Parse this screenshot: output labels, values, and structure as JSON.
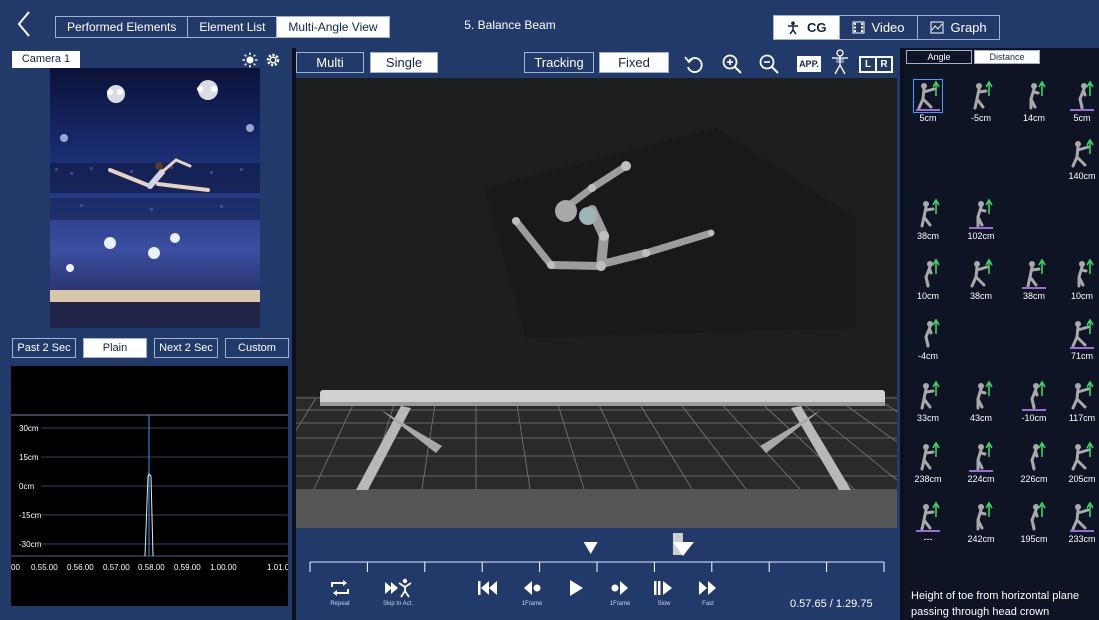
{
  "nav": {
    "back_icon": "back-chevron-icon",
    "tabs": [
      {
        "label": "Performed Elements",
        "active": false
      },
      {
        "label": "Element List",
        "active": false
      },
      {
        "label": "Multi-Angle View",
        "active": true
      }
    ],
    "title": "5. Balance Beam",
    "views": [
      {
        "label": "CG",
        "icon": "figure-icon",
        "active": true
      },
      {
        "label": "Video",
        "icon": "film-icon",
        "active": false
      },
      {
        "label": "Graph",
        "icon": "graph-icon",
        "active": false
      }
    ]
  },
  "camera": {
    "label": "Camera 1",
    "brightness_icon": "sun-icon",
    "settings_icon": "gear-icon"
  },
  "time_buttons": [
    {
      "label": "Past 2 Sec",
      "active": false
    },
    {
      "label": "Plain",
      "active": true
    },
    {
      "label": "Next 2 Sec",
      "active": false
    },
    {
      "label": "Custom",
      "active": false
    }
  ],
  "graph": {
    "y_ticks": [
      "30cm",
      "15cm",
      "0cm",
      "-15cm",
      "-30cm"
    ],
    "x_ticks": [
      "00",
      "0.55.00",
      "0.56.00",
      "0.57.00",
      "0.58.00",
      "0.59.00",
      "1.00.00",
      "1.01.0"
    ],
    "marker_position": 0.5765
  },
  "modes": {
    "view": [
      {
        "label": "Multi",
        "active": false
      },
      {
        "label": "Single",
        "active": true
      }
    ],
    "camera": [
      {
        "label": "Tracking",
        "active": false
      },
      {
        "label": "Fixed",
        "active": true
      }
    ],
    "app_label": "APP.",
    "left_label": "L",
    "right_label": "R",
    "tool_icons": [
      "rotate-reset-icon",
      "zoom-in-icon",
      "zoom-out-icon"
    ]
  },
  "timeline": {
    "progress": 0.6,
    "playhead": 0.648,
    "start_marker": 0.489
  },
  "controls": [
    {
      "caption": "Repeat",
      "icon": "repeat-icon"
    },
    {
      "caption": "Skip to Act.",
      "icon": "skip-to-action-icon"
    },
    {
      "caption": "",
      "icon": "skip-to-start-icon"
    },
    {
      "caption": "1Frame",
      "icon": "frame-back-icon"
    },
    {
      "caption": "",
      "icon": "play-icon"
    },
    {
      "caption": "1Frame",
      "icon": "frame-forward-icon"
    },
    {
      "caption": "Slow",
      "icon": "slow-icon"
    },
    {
      "caption": "Fast",
      "icon": "fast-icon"
    }
  ],
  "time_readout": "0.57.65 / 1.29.75",
  "measure": {
    "tabs": [
      {
        "label": "Angle",
        "active": false
      },
      {
        "label": "Distance",
        "active": true
      }
    ],
    "cells": [
      {
        "value": "5cm",
        "icon": "head-height-pose-icon",
        "selected": true
      },
      {
        "value": "-5cm",
        "icon": "crouch-pose-icon",
        "selected": false
      },
      {
        "value": "14cm",
        "icon": "arms-up-pose-icon",
        "selected": false
      },
      {
        "value": "5cm",
        "icon": "hip-height-pose-icon",
        "selected": false
      },
      {
        "value": "140cm",
        "icon": "foot-height-pose-icon",
        "selected": false
      },
      {
        "value": "38cm",
        "icon": "lean-pose-icon",
        "selected": false
      },
      {
        "value": "102cm",
        "icon": "split-pose-icon",
        "selected": false
      },
      {
        "value": "10cm",
        "icon": "knee-pose-icon",
        "selected": false
      },
      {
        "value": "38cm",
        "icon": "reach-pose-icon",
        "selected": false
      },
      {
        "value": "38cm",
        "icon": "leap-pose-icon",
        "selected": false
      },
      {
        "value": "10cm",
        "icon": "kick-pose-icon",
        "selected": false
      },
      {
        "value": "-4cm",
        "icon": "stand-pose-icon",
        "selected": false
      },
      {
        "value": "71cm",
        "icon": "bend-pose-icon",
        "selected": false
      },
      {
        "value": "33cm",
        "icon": "sit-pose-icon",
        "selected": false
      },
      {
        "value": "43cm",
        "icon": "step-pose-icon",
        "selected": false
      },
      {
        "value": "-10cm",
        "icon": "squat-pose-icon",
        "selected": false
      },
      {
        "value": "117cm",
        "icon": "arch-pose-icon",
        "selected": false
      },
      {
        "value": "238cm",
        "icon": "seated-pose-icon",
        "selected": false
      },
      {
        "value": "224cm",
        "icon": "landing-pose-icon",
        "selected": false
      },
      {
        "value": "226cm",
        "icon": "tuck-pose-icon",
        "selected": false
      },
      {
        "value": "205cm",
        "icon": "pike-pose-icon",
        "selected": false
      },
      {
        "value": "---",
        "icon": "gear-pose-icon",
        "selected": false
      },
      {
        "value": "242cm",
        "icon": "lunge-pose-icon",
        "selected": false
      },
      {
        "value": "195cm",
        "icon": "jump-pose-icon",
        "selected": false
      },
      {
        "value": "233cm",
        "icon": "turn-pose-icon",
        "selected": false
      }
    ],
    "description": "Height of toe from horizontal plane passing through head crown"
  }
}
